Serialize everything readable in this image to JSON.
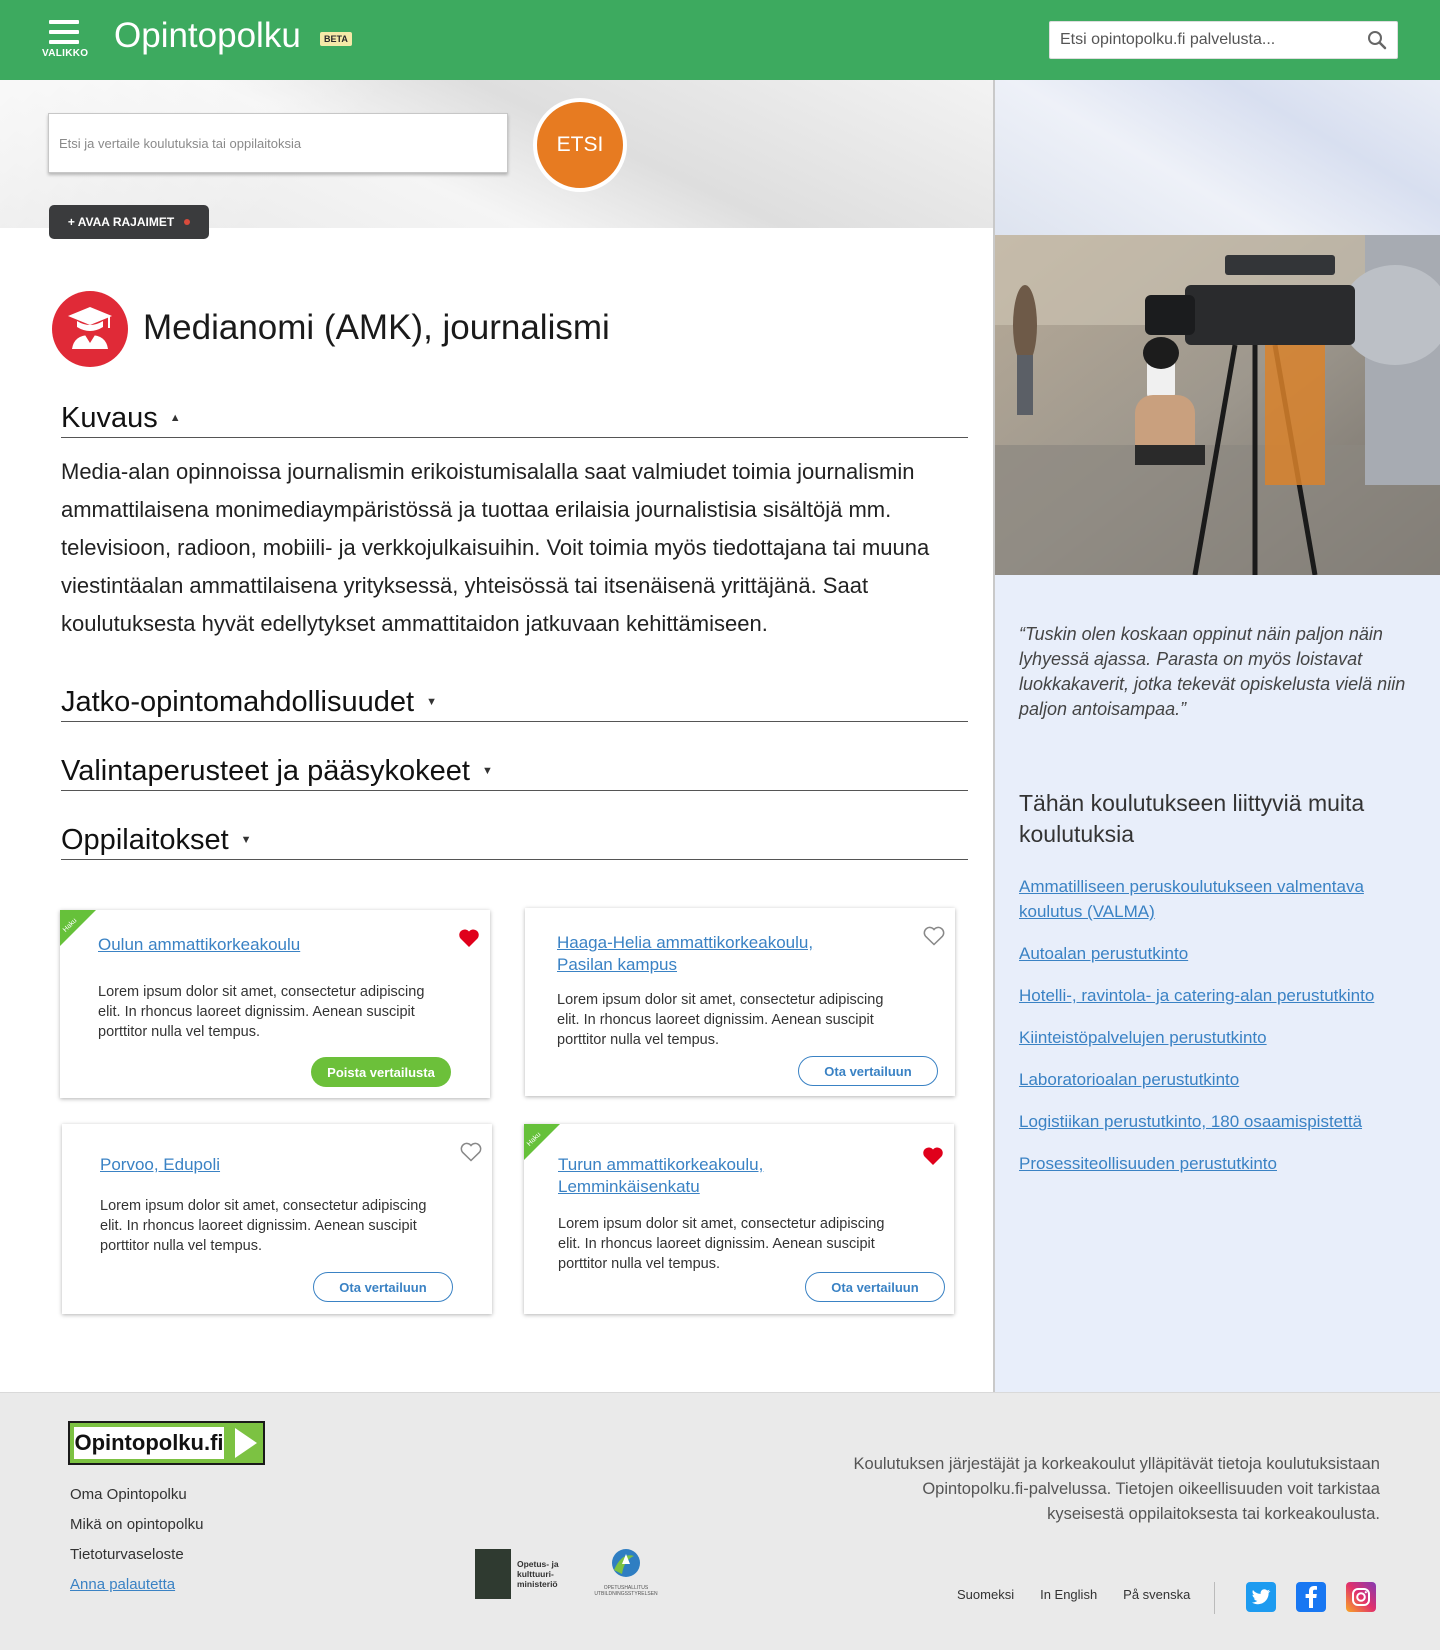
{
  "header": {
    "menu_label": "VALIKKO",
    "logo": "Opintopolku",
    "beta": "BETA",
    "search_placeholder": "Etsi opintopolku.fi palvelusta..."
  },
  "hero": {
    "search_placeholder": "Etsi ja vertaile koulutuksia tai oppilaitoksia",
    "search_button": "ETSI",
    "filters_button": "+ AVAA RAJAIMET"
  },
  "main": {
    "title": "Medianomi (AMK), journalismi",
    "sections": {
      "kuvaus": "Kuvaus",
      "jatko": "Jatko-opintomahdollisuudet",
      "valinta": "Valintaperusteet ja pääsykokeet",
      "oppilaitokset": "Oppilaitokset"
    },
    "description": "Media-alan opinnoissa journalismin erikoistumisalalla saat valmiudet toimia journalismin ammattilaisena monimediaympäristössä ja tuottaa erilaisia journalistisia sisältöjä mm. televisioon, radioon, mobiili- ja verkkojulkaisuihin. Voit toimia myös tiedottajana tai muuna viestintäalan ammattilaisena yrityksessä, yhteisössä tai itsenäisenä yrittäjänä. Saat koulutuksesta hyvät edellytykset ammattitaidon jatkuvaan kehittämiseen."
  },
  "cards": [
    {
      "title": "Oulun ammattikorkeakoulu",
      "text": "Lorem ipsum dolor sit amet, consectetur adipiscing elit. In rhoncus laoreet dignissim. Aenean suscipit porttitor nulla vel tempus.",
      "button": "Poista vertailusta",
      "haku": "Haku"
    },
    {
      "title": "Haaga-Helia ammattikorkeakoulu, Pasilan kampus",
      "text": "Lorem ipsum dolor sit amet, consectetur adipiscing elit. In rhoncus laoreet dignissim. Aenean suscipit porttitor nulla vel tempus.",
      "button": "Ota vertailuun"
    },
    {
      "title": "Porvoo, Edupoli",
      "text": "Lorem ipsum dolor sit amet, consectetur adipiscing elit. In rhoncus laoreet dignissim. Aenean suscipit porttitor nulla vel tempus.",
      "button": "Ota vertailuun"
    },
    {
      "title": "Turun ammattikorkeakoulu, Lemminkäisenkatu",
      "text": "Lorem ipsum dolor sit amet, consectetur adipiscing elit. In rhoncus laoreet dignissim. Aenean suscipit porttitor nulla vel tempus.",
      "button": "Ota vertailuun",
      "haku": "Haku"
    }
  ],
  "sidebar": {
    "quote": "“Tuskin olen koskaan oppinut näin paljon näin lyhyessä ajassa. Parasta on myös loistavat luokkakaverit, jotka tekevät opiskelusta vielä niin paljon antoisampaa.”",
    "related_title": "Tähän koulutukseen liittyviä muita koulutuksia",
    "related": [
      "Ammatilliseen peruskoulutukseen valmentava koulutus (VALMA)",
      "Autoalan perustutkinto",
      "Hotelli-, ravintola- ja catering-alan perustutkinto",
      "Kiinteistöpalvelujen perustutkinto",
      "Laboratorioalan perustutkinto",
      "Logistiikan perustutkinto, 180 osaamispistettä",
      "Prosessiteollisuuden perustutkinto"
    ]
  },
  "footer": {
    "logo": "Opintopolku.fi",
    "links": [
      "Oma Opintopolku",
      "Mikä on opintopolku",
      "Tietoturvaseloste",
      "Anna palautetta"
    ],
    "info": "Koulutuksen järjestäjät ja korkeakoulut ylläpitävät tietoja koulutuksistaan Opintopolku.fi-palvelussa. Tietojen oikeellisuuden voit tarkistaa kyseisestä oppilaitoksesta tai korkeakoulusta.",
    "okm": "Opetus- ja kulttuuri- ministeriö",
    "oph": "OPETUSHALLITUS UTBILDNINGSSTYRELSEN",
    "languages": [
      "Suomeksi",
      "In English",
      "På svenska"
    ]
  },
  "colors": {
    "brand_green": "#3daa5f",
    "accent_orange": "#e77b21",
    "link_blue": "#3a82c4",
    "sidebar_bg": "#e8eefa",
    "heart_red": "#e0001b"
  }
}
